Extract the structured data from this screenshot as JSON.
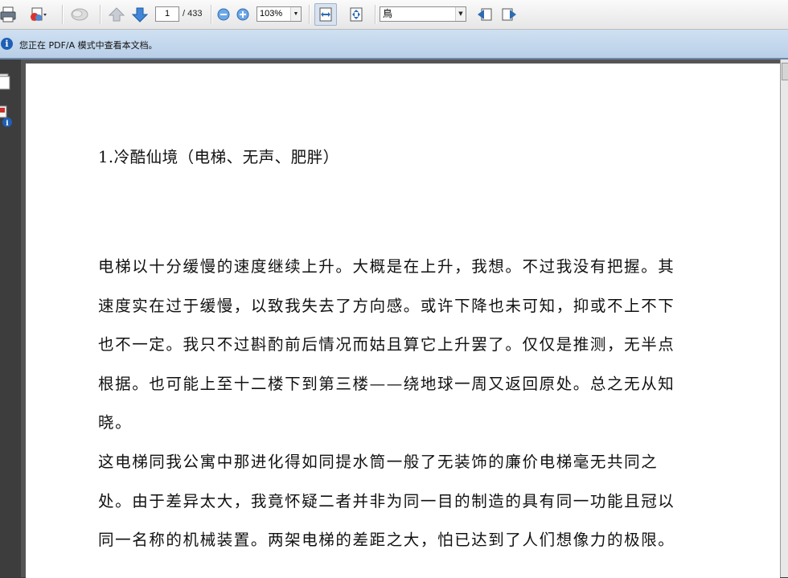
{
  "toolbar": {
    "page_current": "1",
    "page_total": "/ 433",
    "zoom": "103%",
    "search_value": "鳥"
  },
  "notice": {
    "icon": "info-icon",
    "message": "您正在 PDF/A 模式中查看本文档。"
  },
  "document": {
    "heading": "1.冷酷仙境（电梯、无声、肥胖）",
    "paragraph1": [
      "电梯以十分缓慢的速度继续上升。大概是在上升，我想。不过我没有把握。其",
      "速度实在过于缓慢，以致我失去了方向感。或许下降也未可知，抑或不上不下",
      "也不一定。我只不过斟酌前后情况而姑且算它上升罢了。仅仅是推测，无半点",
      "根据。也可能上至十二楼下到第三楼——绕地球一周又返回原处。总之无从知",
      "晓。"
    ],
    "paragraph2": [
      "这电梯同我公寓中那进化得如同提水筒一般了无装饰的廉价电梯毫无共同之",
      "处。由于差异太大，我竟怀疑二者并非为同一目的制造的具有同一功能且冠以",
      "同一名称的机械装置。两架电梯的差距之大，怕已达到了人们想像力的极限。"
    ]
  },
  "colors": {
    "notice_bg": "#c4d7ec",
    "info_icon": "#1e5fb4",
    "page_bg": "#ffffff",
    "frame_bg": "#3b3b3b"
  }
}
